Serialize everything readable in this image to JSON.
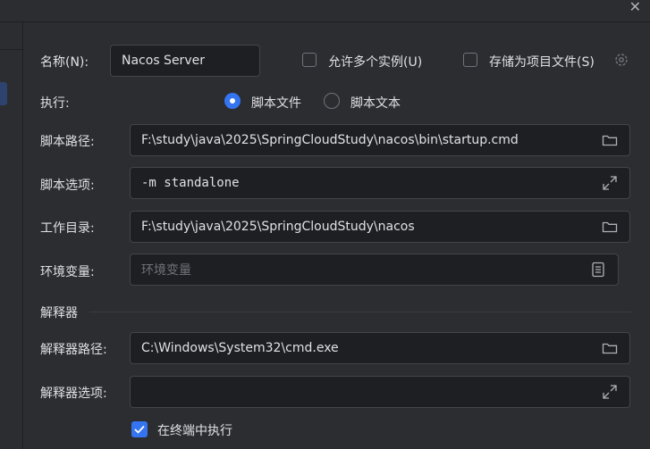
{
  "window": {
    "close_glyph": "✕"
  },
  "name": {
    "label": "名称(N):",
    "value": "Nacos Server"
  },
  "options": {
    "allow_multiple": "允许多个实例(U)",
    "store_as_project_file": "存储为项目文件(S)"
  },
  "execute": {
    "label": "执行:",
    "radio_script_file": "脚本文件",
    "radio_script_text": "脚本文本",
    "selected": "脚本文件"
  },
  "fields": {
    "script_path": {
      "label": "脚本路径:",
      "value": "F:\\study\\java\\2025\\SpringCloudStudy\\nacos\\bin\\startup.cmd",
      "icon": "folder-icon"
    },
    "script_options": {
      "label": "脚本选项:",
      "value": "-m standalone",
      "icon": "expand-icon"
    },
    "working_dir": {
      "label": "工作目录:",
      "value": "F:\\study\\java\\2025\\SpringCloudStudy\\nacos",
      "icon": "folder-icon"
    },
    "env_vars": {
      "label": "环境变量:",
      "placeholder": "环境变量",
      "icon": "document-icon"
    }
  },
  "interpreter": {
    "section_title": "解释器",
    "path": {
      "label": "解释器路径:",
      "value": "C:\\Windows\\System32\\cmd.exe",
      "icon": "folder-icon"
    },
    "options": {
      "label": "解释器选项:",
      "value": "",
      "icon": "expand-icon"
    }
  },
  "terminal": {
    "label": "在终端中执行",
    "checked": true
  },
  "colors": {
    "accent": "#3574f0",
    "background": "#2b2d30",
    "field_bg": "#1e1f22",
    "border": "#43454a"
  }
}
